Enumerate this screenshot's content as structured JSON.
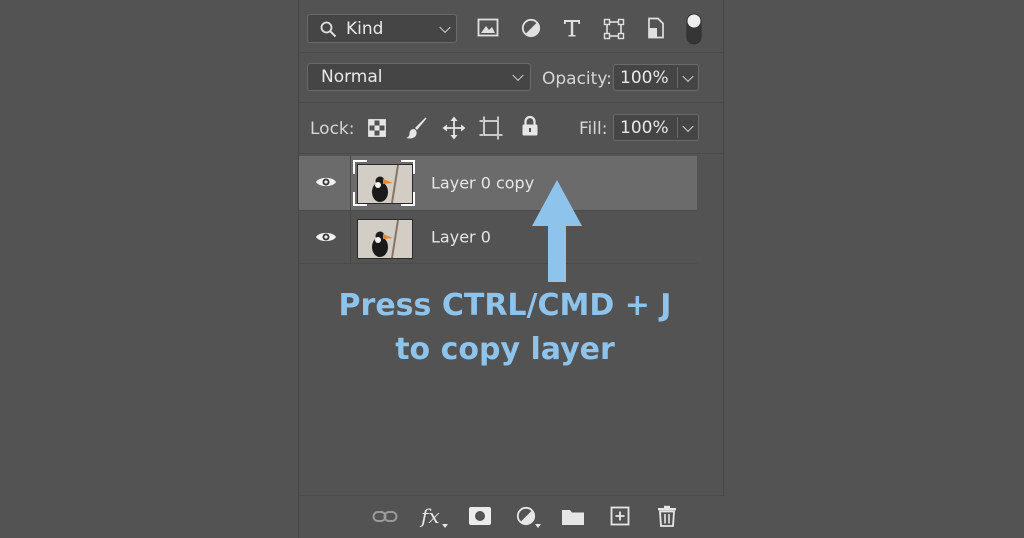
{
  "filter_row": {
    "kind_label": "Kind",
    "icons": [
      "image-filter-icon",
      "adjustment-filter-icon",
      "type-filter-icon",
      "shape-filter-icon",
      "smart-object-filter-icon",
      "filter-toggle-icon"
    ]
  },
  "blend_row": {
    "blend_mode": "Normal",
    "opacity_label": "Opacity:",
    "opacity_value": "100%"
  },
  "lock_row": {
    "lock_label": "Lock:",
    "fill_label": "Fill:",
    "fill_value": "100%",
    "icons": [
      "lock-transparent-pixels-icon",
      "lock-image-pixels-icon",
      "lock-position-icon",
      "lock-artboard-icon",
      "lock-all-icon"
    ]
  },
  "layers": [
    {
      "name": "Layer 0 copy",
      "selected": true,
      "visible": true
    },
    {
      "name": "Layer 0",
      "selected": false,
      "visible": true
    }
  ],
  "annotation": {
    "line1": "Press CTRL/CMD + J",
    "line2": "to copy layer",
    "color": "#8ec3ec"
  },
  "bottom_bar": {
    "fx_label": "fx",
    "icons": [
      "link-layers-icon",
      "fx-icon",
      "layer-mask-icon",
      "adjustment-layer-icon",
      "new-group-icon",
      "new-layer-icon",
      "delete-layer-icon"
    ]
  },
  "colors": {
    "panel_bg": "#535353",
    "selected_row": "#6b6b6b",
    "field_bg": "#454545",
    "arrow": "#8ec3ec"
  }
}
